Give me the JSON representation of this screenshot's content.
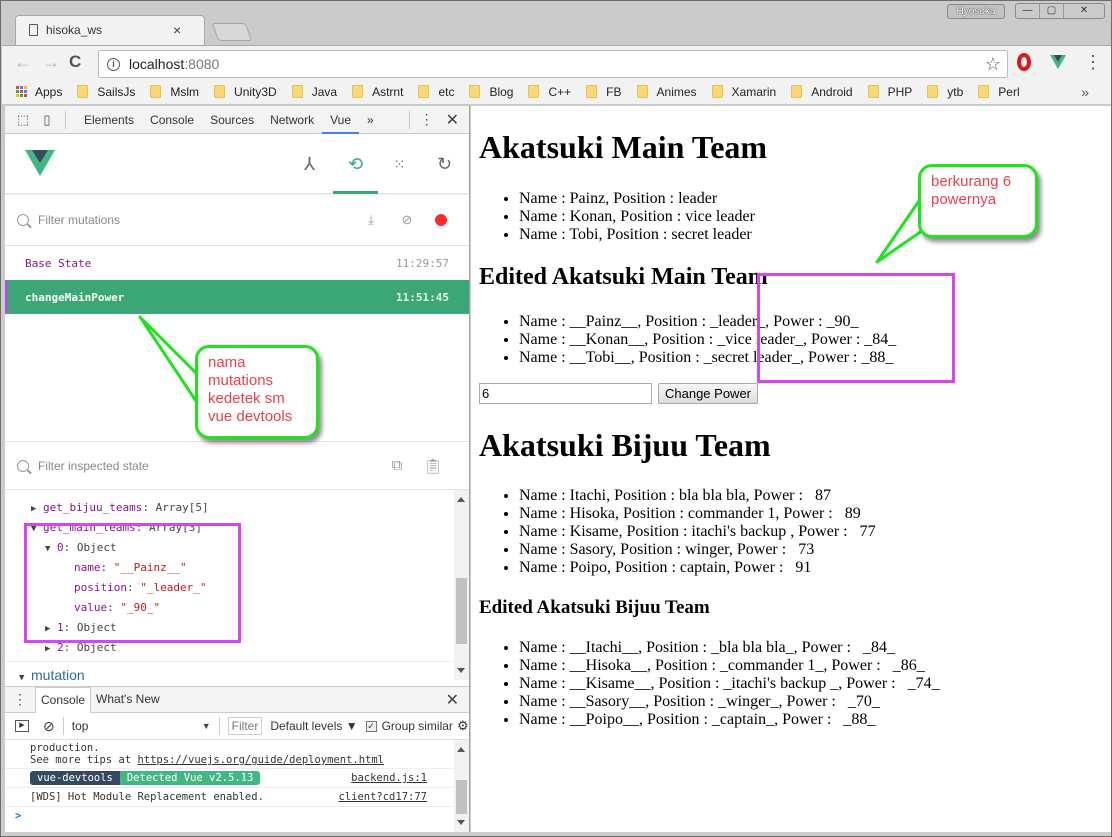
{
  "window": {
    "user_badge": "Hyosoka",
    "controls": [
      "—",
      "▢",
      "✕"
    ]
  },
  "tab": {
    "title": "hisoka_ws",
    "close": "×"
  },
  "toolbar": {
    "back": "←",
    "forward": "→",
    "reload": "C",
    "url_host": "localhost",
    "url_port": ":8080",
    "star": "☆",
    "menu": "⋮"
  },
  "bookmarks": {
    "items": [
      "Apps",
      "SailsJs",
      "Mslm",
      "Unity3D",
      "Java",
      "Astrnt",
      "etc",
      "Blog",
      "C++",
      "FB",
      "Animes",
      "Xamarin",
      "Android",
      "PHP",
      "ytb",
      "Perl"
    ],
    "more": "»"
  },
  "devtools": {
    "tabs": [
      "Elements",
      "Console",
      "Sources",
      "Network",
      "Vue"
    ],
    "active_tab": "Vue",
    "more_tabs": "»",
    "close": "✕",
    "vue": {
      "filter_mutations_placeholder": "Filter mutations",
      "mutations": [
        {
          "name": "Base State",
          "time": "11:29:57"
        },
        {
          "name": "changeMainPower",
          "time": "11:51:45"
        }
      ],
      "filter_state_placeholder": "Filter inspected state",
      "state_tree": {
        "bijuu_key": "get_bijuu_teams",
        "bijuu_type": "Array[5]",
        "main_key": "get_main_teams",
        "main_type": "Array[3]",
        "item0_key": "0",
        "object_label": "Object",
        "item0": {
          "name_key": "name",
          "name_val": "\"__Painz__\"",
          "position_key": "position",
          "position_val": "\"_leader_\"",
          "value_key": "value",
          "value_val": "\"_90_\""
        },
        "item1_key": "1",
        "item2_key": "2",
        "section": "mutation"
      }
    },
    "drawer": {
      "tabs": [
        "Console",
        "What's New"
      ],
      "context": "top",
      "filter": "Filter",
      "levels": "Default levels ▼",
      "group_similar": "Group similar",
      "lines": {
        "l1": "production.",
        "l2_prefix": "See more tips at ",
        "l2_link": "https://vuejs.org/guide/deployment.html",
        "badge_left": "vue-devtools",
        "badge_right": "Detected Vue v2.5.13",
        "badge_src": "backend.js:1",
        "l4": "[WDS] Hot Module Replacement enabled.",
        "l4_src": "client?cd17:77",
        "prompt": ">"
      }
    }
  },
  "page": {
    "main_title": "Akatsuki Main Team",
    "main_team": [
      "Name : Painz, Position : leader",
      "Name : Konan, Position : vice leader",
      "Name : Tobi, Position : secret leader"
    ],
    "edited_main_title": "Edited Akatsuki Main Team",
    "edited_main_team": [
      "Name : __Painz__, Position : _leader_, Power : _90_",
      "Name : __Konan__, Position : _vice leader_, Power : _84_",
      "Name : __Tobi__, Position : _secret leader_, Power : _88_"
    ],
    "power_input_value": "6",
    "change_power_label": "Change Power",
    "bijuu_title": "Akatsuki Bijuu Team",
    "bijuu_team": [
      "Name : Itachi, Position : bla bla bla, Power :   87",
      "Name : Hisoka, Position : commander 1, Power :   89",
      "Name : Kisame, Position : itachi's backup , Power :   77",
      "Name : Sasory, Position : winger, Power :   73",
      "Name : Poipo, Position : captain, Power :   91"
    ],
    "edited_bijuu_title": "Edited Akatsuki Bijuu Team",
    "edited_bijuu_team": [
      "Name : __Itachi__, Position : _bla bla bla_, Power :   _84_",
      "Name : __Hisoka__, Position : _commander 1_, Power :   _86_",
      "Name : __Kisame__, Position : _itachi's backup _, Power :   _74_",
      "Name : __Sasory__, Position : _winger_, Power :   _70_",
      "Name : __Poipo__, Position : _captain_, Power :   _88_"
    ]
  },
  "annotations": {
    "callout_mutation": "nama\nmutations\nkedetek sm\nvue devtools",
    "callout_power": "berkurang 6\npowernya"
  },
  "colors": {
    "vue_green": "#3ba776",
    "vue_dark": "#34495e",
    "highlight": "#d547f5",
    "callout_border": "#1ee41e",
    "callout_text": "#e8414a"
  }
}
